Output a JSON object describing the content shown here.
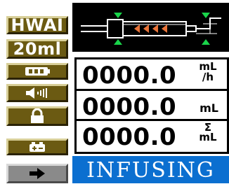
{
  "buttons": {
    "drug_label": "HWAI",
    "syringe_size_label": "20ml",
    "battery_icon": "battery-icon",
    "volume_icon": "speaker-volume-icon",
    "lock_icon": "lock-icon",
    "power_icon": "power-plug-icon",
    "next_icon": "arrow-right-icon"
  },
  "readouts": {
    "rate": {
      "value": "0000.0",
      "unit_top": "mL",
      "unit_bottom": "/h"
    },
    "volume": {
      "value": "0000.0",
      "unit": "mL"
    },
    "total": {
      "value": "0000.0",
      "unit_top": "Σ",
      "unit_bottom": "mL"
    }
  },
  "status": {
    "text": "INFUSING"
  },
  "colors": {
    "button_bg": "#6b5a12",
    "status_bg": "#0b6fd0",
    "arrow_color": "#e8743a",
    "marker_color": "#19d44a"
  }
}
